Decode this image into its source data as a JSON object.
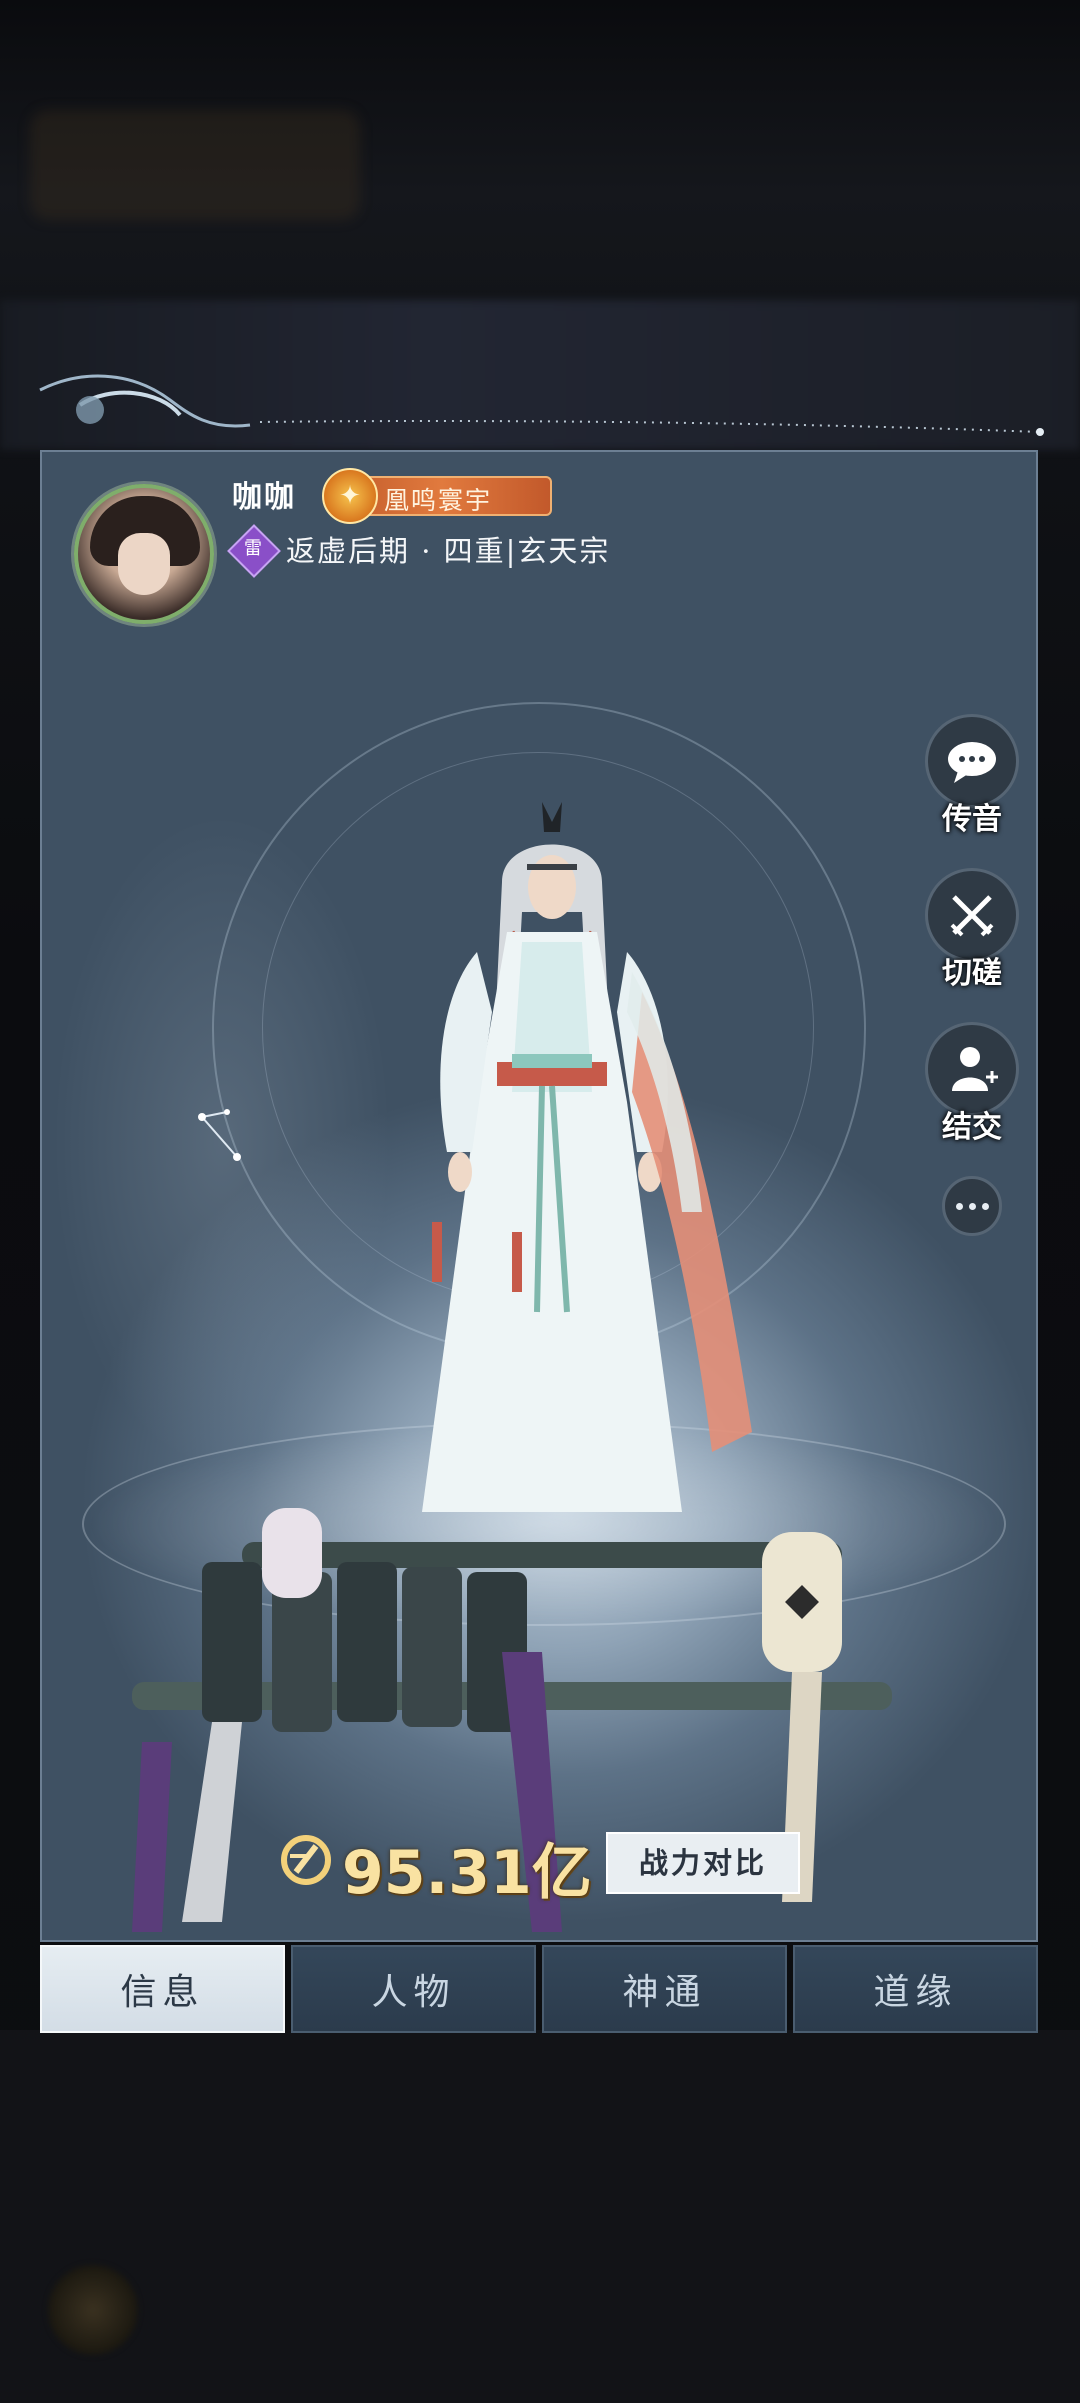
{
  "player": {
    "name": "咖咖",
    "title_badge": "凰鸣寰宇",
    "element": "雷",
    "realm": "返虚后期 · 四重|玄天宗"
  },
  "actions": [
    {
      "label": "传音",
      "icon": "chat-bubble-icon"
    },
    {
      "label": "切磋",
      "icon": "crossed-swords-icon"
    },
    {
      "label": "结交",
      "icon": "add-friend-icon"
    }
  ],
  "more_icon": "ellipsis-icon",
  "power": {
    "value": "95.31亿",
    "compare_label": "战力对比"
  },
  "tabs": [
    {
      "label": "信息",
      "active": true
    },
    {
      "label": "人物",
      "active": false
    },
    {
      "label": "神通",
      "active": false
    },
    {
      "label": "道缘",
      "active": false
    }
  ],
  "colors": {
    "title_badge": "#e17a3e",
    "power_text": "#f9e2a2",
    "element_purple": "#8a4fc8",
    "panel_blue": "#5d7287"
  }
}
